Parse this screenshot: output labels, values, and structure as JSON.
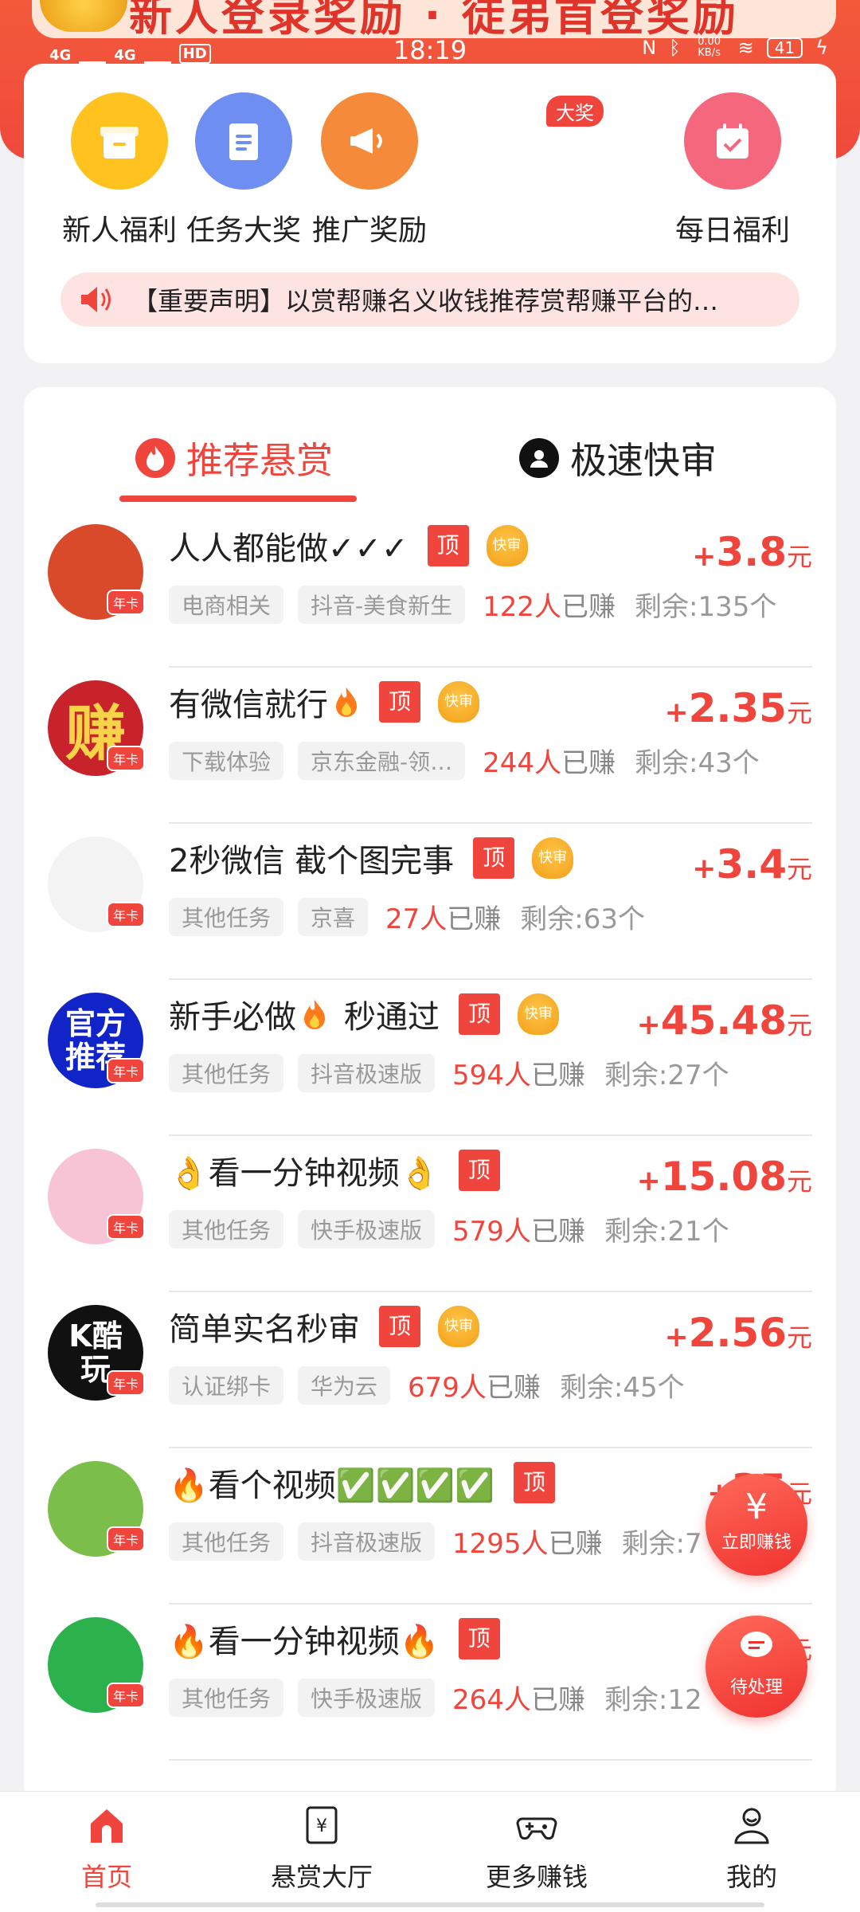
{
  "banner": {
    "text": "新人登录奖励 · 徒弟首登奖励"
  },
  "status_bar": {
    "net1": "4G",
    "net2": "4G",
    "hd": "HD",
    "time": "18:19",
    "speed": "0.00 KB/s",
    "battery": "41"
  },
  "features": [
    {
      "label": "新人福利",
      "color": "#ffc21f",
      "icon": "gift-box-icon"
    },
    {
      "label": "任务大奖",
      "color": "#6f8ef2",
      "icon": "clipboard-icon"
    },
    {
      "label": "推广奖励",
      "color": "#f58b3a",
      "icon": "megaphone-icon",
      "badge": "大奖"
    },
    {
      "label": "每日福利",
      "color": "#f5677d",
      "icon": "calendar-check-icon"
    }
  ],
  "notice": {
    "text": "【重要声明】以赏帮赚名义收钱推荐赏帮赚平台的…"
  },
  "tabs": {
    "recommended": "推荐悬赏",
    "fast": "极速快审"
  },
  "labels": {
    "top": "顶",
    "fast": "快审",
    "earned": "已赚",
    "vip": "年卡",
    "unit": "元",
    "plus": "+"
  },
  "tasks": [
    {
      "title": "人人都能做✓✓✓",
      "fire": false,
      "fast": true,
      "tags": [
        "电商相关",
        "抖音-美食新生"
      ],
      "count": "122人",
      "remain": "剩余:135个",
      "reward": "3.8",
      "avatar_color": "#d84a2a",
      "avatar_text": ""
    },
    {
      "title": "有微信就行",
      "fire": true,
      "fast": true,
      "tags": [
        "下载体验",
        "京东金融-领…"
      ],
      "count": "244人",
      "remain": "剩余:43个",
      "reward": "2.35",
      "avatar_color": "#c8232b",
      "avatar_text": "赚"
    },
    {
      "title": "2秒微信 截个图完事",
      "fire": false,
      "fast": true,
      "tags": [
        "其他任务",
        "京喜"
      ],
      "count": "27人",
      "remain": "剩余:63个",
      "reward": "3.4",
      "avatar_color": "#f3f3f3",
      "avatar_text": ""
    },
    {
      "title": "新手必做",
      "title2": "秒通过",
      "fire": true,
      "fast": true,
      "tags": [
        "其他任务",
        "抖音极速版"
      ],
      "count": "594人",
      "remain": "剩余:27个",
      "reward": "45.48",
      "avatar_color": "#1024c8",
      "avatar_text": "官方推荐"
    },
    {
      "title": "👌看一分钟视频👌",
      "fire": false,
      "fast": false,
      "tags": [
        "其他任务",
        "快手极速版"
      ],
      "count": "579人",
      "remain": "剩余:21个",
      "reward": "15.08",
      "avatar_color": "#f6c4d4",
      "avatar_text": ""
    },
    {
      "title": "简单实名秒审",
      "fire": false,
      "fast": true,
      "tags": [
        "认证绑卡",
        "华为云"
      ],
      "count": "679人",
      "remain": "剩余:45个",
      "reward": "2.56",
      "avatar_color": "#111111",
      "avatar_text": "K酷玩"
    },
    {
      "title": "🔥看个视频✅✅✅✅",
      "fire": false,
      "fast": false,
      "tags": [
        "其他任务",
        "抖音极速版"
      ],
      "count": "1295人",
      "remain": "剩余:7",
      "reward": "35",
      "avatar_color": "#7bbf4a",
      "avatar_text": ""
    },
    {
      "title": "🔥看一分钟视频🔥",
      "fire": false,
      "fast": false,
      "tags": [
        "其他任务",
        "快手极速版"
      ],
      "count": "264人",
      "remain": "剩余:12",
      "reward": "12",
      "avatar_color": "#2bb24c",
      "avatar_text": ""
    }
  ],
  "float_buttons": {
    "earn": "立即赚钱",
    "earn_symbol": "¥",
    "pending": "待处理"
  },
  "nav": [
    {
      "label": "首页",
      "icon": "home-icon",
      "active": true
    },
    {
      "label": "悬赏大厅",
      "icon": "yuan-doc-icon",
      "active": false
    },
    {
      "label": "更多赚钱",
      "icon": "gamepad-icon",
      "active": false
    },
    {
      "label": "我的",
      "icon": "user-icon",
      "active": false
    }
  ],
  "colors": {
    "accent": "#f0453c",
    "background": "#f2f2f4"
  }
}
